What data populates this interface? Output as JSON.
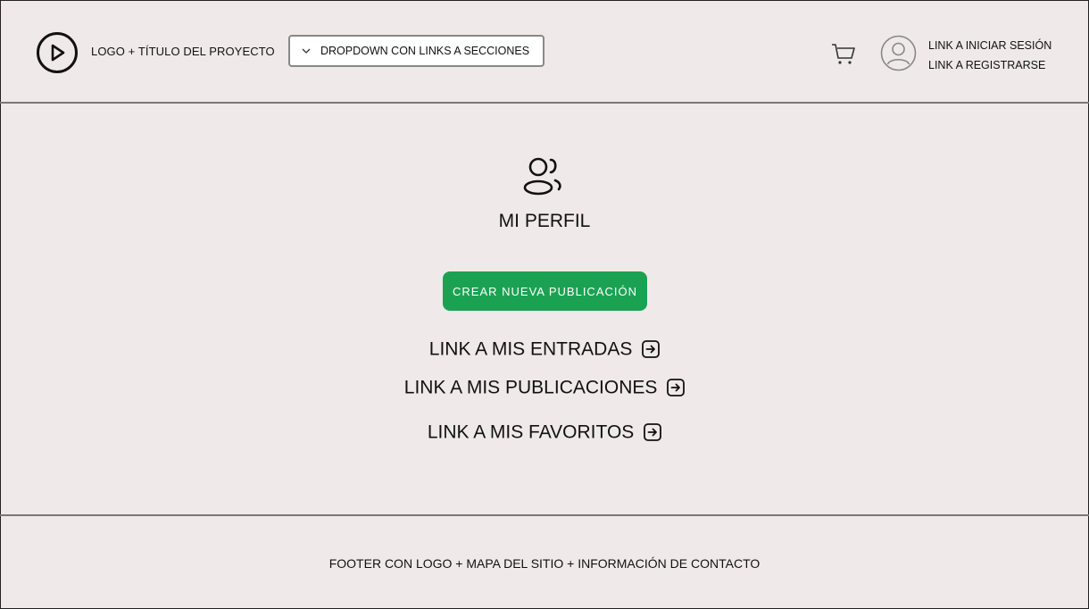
{
  "header": {
    "logo_icon": "play-circle-icon",
    "logo_title": "LOGO + TÍTULO DEL PROYECTO",
    "dropdown_label": "DROPDOWN CON LINKS A SECCIONES",
    "cart_icon": "cart-icon",
    "avatar_icon": "user-avatar-icon",
    "login_link": "LINK A INICIAR SESIÓN",
    "register_link": "LINK A REGISTRARSE"
  },
  "main": {
    "profile_icon": "users-icon",
    "title": "MI PERFIL",
    "cta_label": "CREAR NUEVA PUBLICACIÓN",
    "links": [
      {
        "label": "LINK A MIS ENTRADAS",
        "icon": "arrow-right-square-icon"
      },
      {
        "label": "LINK A MIS PUBLICACIONES",
        "icon": "arrow-right-square-icon"
      },
      {
        "label": "LINK A MIS FAVORITOS",
        "icon": "arrow-right-square-icon"
      }
    ]
  },
  "footer": {
    "text": "FOOTER CON LOGO + MAPA DEL SITIO + INFORMACIÓN DE CONTACTO"
  },
  "colors": {
    "background": "#f0e9e9",
    "accent": "#1aa252",
    "border": "#777777"
  }
}
